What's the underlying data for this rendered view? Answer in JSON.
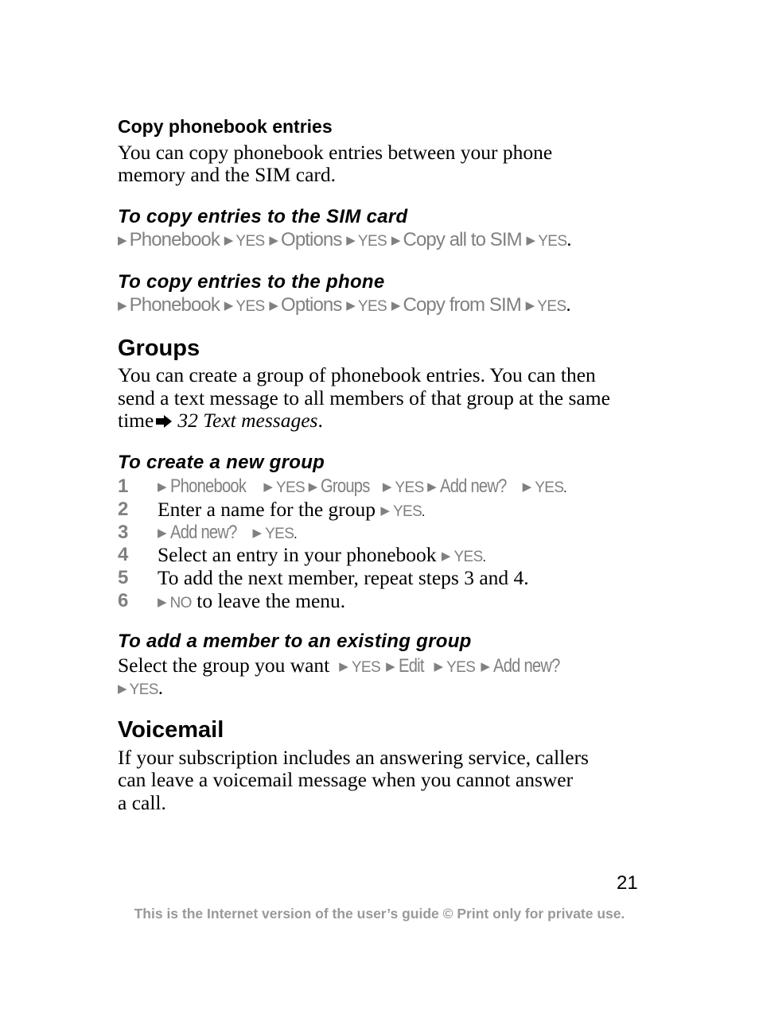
{
  "colors": {
    "text": "#000000",
    "menu_gray": "#808080",
    "footer_gray": "#999999"
  },
  "copy_section": {
    "title": "Copy phonebook entries",
    "body_line1": "You can copy phonebook entries between your phone",
    "body_line2": "memory and the SIM card.",
    "to_sim": {
      "heading": "To copy entries to the SIM card",
      "path": [
        "Phonebook",
        "YES",
        "Options",
        "YES",
        "Copy all to SIM",
        "YES"
      ]
    },
    "to_phone": {
      "heading": "To copy entries to the phone",
      "path": [
        "Phonebook",
        "YES",
        "Options",
        "YES",
        "Copy from SIM",
        "YES"
      ]
    }
  },
  "groups_section": {
    "title": "Groups",
    "body_line1": "You can create a group of phonebook entries. You can then",
    "body_line2": "send a text message to all members of that group at the same",
    "body_line3_prefix": "time",
    "reference_icon": "right-arrow-reference-icon",
    "reference_text": "32 Text messages",
    "reference_suffix": ".",
    "create_group": {
      "heading": "To create a new group",
      "steps": [
        {
          "number": "1",
          "path": [
            "Phonebook",
            "YES",
            "Groups",
            "YES",
            "Add new?",
            "YES"
          ]
        },
        {
          "number": "2",
          "text": "Enter a name for the group",
          "key": "YES"
        },
        {
          "number": "3",
          "path": [
            "Add new?",
            "YES"
          ]
        },
        {
          "number": "4",
          "text": "Select an entry in your phonebook",
          "key": "YES"
        },
        {
          "number": "5",
          "text": "To add the next member, repeat steps 3 and 4."
        },
        {
          "number": "6",
          "key": "NO",
          "text": "to leave the menu."
        }
      ]
    },
    "add_member": {
      "heading": "To add a member to an existing group",
      "text": "Select the group you want",
      "path_line1": [
        "YES",
        "Edit",
        "YES",
        "Add new?"
      ],
      "path_line2": [
        "YES"
      ]
    }
  },
  "voicemail_section": {
    "title": "Voicemail",
    "body_line1": "If your subscription includes an answering service, callers",
    "body_line2": "can leave a voicemail message when you cannot answer",
    "body_line3": "a call."
  },
  "page_number": "21",
  "footer": "This is the Internet version of the user’s guide © Print only for private use."
}
